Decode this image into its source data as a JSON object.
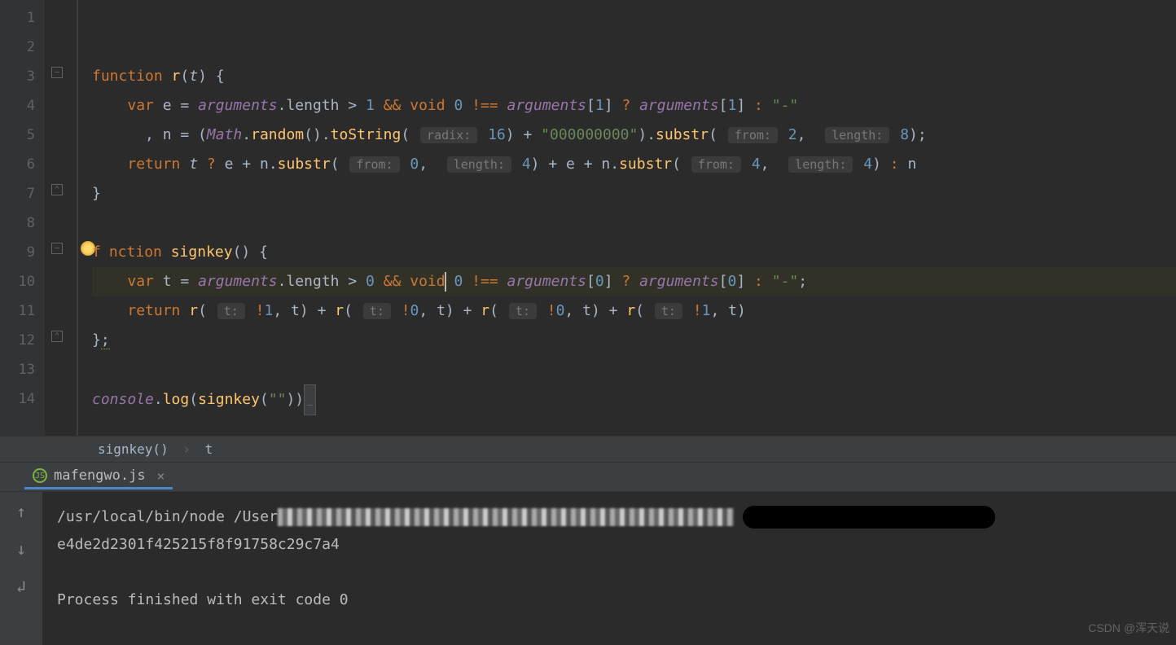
{
  "lines": [
    "1",
    "2",
    "3",
    "4",
    "5",
    "6",
    "7",
    "8",
    "9",
    "10",
    "11",
    "12",
    "13",
    "14"
  ],
  "code": {
    "l3": {
      "kw_fn": "function",
      "name": "r",
      "param": "t"
    },
    "l4": {
      "kw_var": "var",
      "e": "e",
      "arguments": "arguments",
      "length": "length",
      "num1": "1",
      "op_and": "&&",
      "kw_void": "void",
      "num0": "0",
      "op_neq": "!==",
      "idx1": "1",
      "op_tern": "?",
      "colon": ":",
      "str_dash": "\"-\""
    },
    "l5": {
      "n": "n",
      "Math": "Math",
      "random": "random",
      "toString": "toString",
      "hint_radix": "radix:",
      "num16": "16",
      "plus": "+",
      "str_zeros": "\"000000000\"",
      "substr": "substr",
      "hint_from": "from:",
      "num2": "2",
      "hint_len": "length:",
      "num8": "8"
    },
    "l6": {
      "kw_return": "return",
      "t": "t",
      "op_tern": "?",
      "e": "e",
      "plus": "+",
      "n": "n",
      "substr": "substr",
      "hint_from": "from:",
      "num0": "0",
      "hint_len": "length:",
      "num4": "4",
      "num4b": "4",
      "colon": ":"
    },
    "l9": {
      "kw_fn": "f",
      "kw_fn2": "nction",
      "name": "signkey"
    },
    "l10": {
      "kw_var": "var",
      "t": "t",
      "arguments": "arguments",
      "length": "length",
      "num0": "0",
      "op_and": "&&",
      "kw_void": "void",
      "num0b": "0",
      "op_neq": "!==",
      "idx0": "0",
      "op_tern": "?",
      "colon": ":",
      "str_dash": "\"-\""
    },
    "l11": {
      "kw_return": "return",
      "r": "r",
      "hint_t": "t:",
      "bang1": "!1",
      "bang0": "!0",
      "t": "t",
      "plus": "+"
    },
    "l14": {
      "console": "console",
      "log": "log",
      "signkey": "signkey",
      "str_empty": "\"\""
    }
  },
  "breadcrumb": {
    "fn": "signkey()",
    "var": "t"
  },
  "tab": {
    "filename": "mafengwo.js"
  },
  "terminal": {
    "cmd_prefix": "/usr/local/bin/node /User",
    "output": "e4de2d2301f425215f8f91758c29c7a4",
    "exit": "Process finished with exit code 0"
  },
  "watermark": "CSDN @浑天说"
}
